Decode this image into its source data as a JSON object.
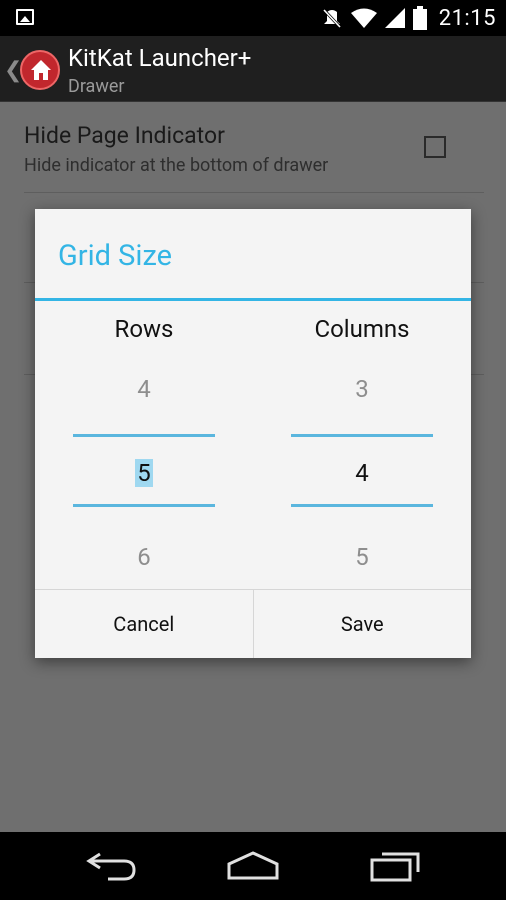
{
  "status_bar": {
    "time": "21:15",
    "icons": [
      "image-notification-icon",
      "mute-icon",
      "wifi-icon",
      "signal-icon",
      "battery-icon"
    ]
  },
  "action_bar": {
    "title": "KitKat Launcher+",
    "subtitle": "Drawer"
  },
  "preference": {
    "title": "Hide Page Indicator",
    "summary": "Hide indicator at the bottom of drawer",
    "checked": false
  },
  "dialog": {
    "title": "Grid Size",
    "rows": {
      "label": "Rows",
      "prev": "4",
      "current": "5",
      "next": "6"
    },
    "columns": {
      "label": "Columns",
      "prev": "3",
      "current": "4",
      "next": "5"
    },
    "cancel_label": "Cancel",
    "save_label": "Save"
  },
  "colors": {
    "accent": "#33b5e5",
    "dim_background": "#6f6f6f",
    "dialog_background": "#f4f4f4"
  },
  "nav_bar": {
    "icons": [
      "back-icon",
      "home-icon",
      "recent-apps-icon"
    ]
  }
}
